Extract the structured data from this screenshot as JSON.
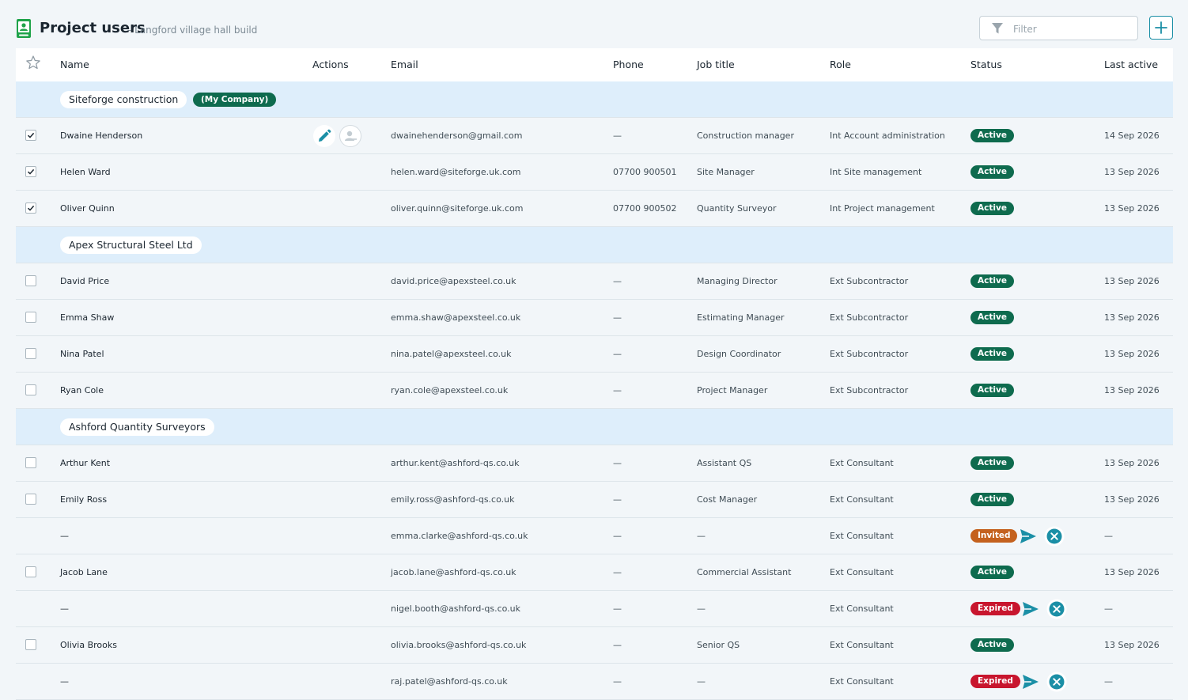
{
  "header": {
    "title": "Project users",
    "subtitle": "- Langford village hall build",
    "filter_placeholder": "Filter"
  },
  "columns": {
    "name": "Name",
    "actions": "Actions",
    "email": "Email",
    "phone": "Phone",
    "job_title": "Job title",
    "role": "Role",
    "status": "Status",
    "last_active": "Last active"
  },
  "colors": {
    "accent": "#1b8fa6",
    "active": "#0e6b4e",
    "invited": "#c4611e",
    "expired": "#c8162e",
    "group_bg": "#deeefb"
  },
  "groups": [
    {
      "name": "Siteforge construction",
      "badge": "(My Company)",
      "users": [
        {
          "checked": true,
          "name": "Dwaine Henderson",
          "email": "dwainehenderson@gmail.com",
          "phone": "—",
          "job_title": "Construction manager",
          "role": "Int Account administration",
          "status": "Active",
          "last_active": "14 Sep 2026",
          "actions": true
        },
        {
          "checked": true,
          "name": "Helen Ward",
          "email": "helen.ward@siteforge.uk.com",
          "phone": "07700 900501",
          "job_title": "Site Manager",
          "role": "Int Site management",
          "status": "Active",
          "last_active": "13 Sep 2026"
        },
        {
          "checked": true,
          "name": "Oliver Quinn",
          "email": "oliver.quinn@siteforge.uk.com",
          "phone": "07700 900502",
          "job_title": "Quantity Surveyor",
          "role": "Int Project management",
          "status": "Active",
          "last_active": "13 Sep 2026"
        }
      ]
    },
    {
      "name": "Apex Structural Steel Ltd",
      "users": [
        {
          "checked": false,
          "name": "David Price",
          "email": "david.price@apexsteel.co.uk",
          "phone": "—",
          "job_title": "Managing Director",
          "role": "Ext Subcontractor",
          "status": "Active",
          "last_active": "13 Sep 2026"
        },
        {
          "checked": false,
          "name": "Emma Shaw",
          "email": "emma.shaw@apexsteel.co.uk",
          "phone": "—",
          "job_title": "Estimating Manager",
          "role": "Ext Subcontractor",
          "status": "Active",
          "last_active": "13 Sep 2026"
        },
        {
          "checked": false,
          "name": "Nina Patel",
          "email": "nina.patel@apexsteel.co.uk",
          "phone": "—",
          "job_title": "Design Coordinator",
          "role": "Ext Subcontractor",
          "status": "Active",
          "last_active": "13 Sep 2026"
        },
        {
          "checked": false,
          "name": "Ryan Cole",
          "email": "ryan.cole@apexsteel.co.uk",
          "phone": "—",
          "job_title": "Project Manager",
          "role": "Ext Subcontractor",
          "status": "Active",
          "last_active": "13 Sep 2026"
        }
      ]
    },
    {
      "name": "Ashford Quantity Surveyors",
      "users": [
        {
          "checked": false,
          "name": "Arthur Kent",
          "email": "arthur.kent@ashford-qs.co.uk",
          "phone": "—",
          "job_title": "Assistant QS",
          "role": "Ext Consultant",
          "status": "Active",
          "last_active": "13 Sep 2026"
        },
        {
          "checked": false,
          "name": "Emily Ross",
          "email": "emily.ross@ashford-qs.co.uk",
          "phone": "—",
          "job_title": "Cost Manager",
          "role": "Ext Consultant",
          "status": "Active",
          "last_active": "13 Sep 2026"
        },
        {
          "checked": null,
          "name": "—",
          "email": "emma.clarke@ashford-qs.co.uk",
          "phone": "—",
          "job_title": "—",
          "role": "Ext Consultant",
          "status": "Invited",
          "last_active": "—",
          "invite_actions": true
        },
        {
          "checked": false,
          "name": "Jacob Lane",
          "email": "jacob.lane@ashford-qs.co.uk",
          "phone": "—",
          "job_title": "Commercial Assistant",
          "role": "Ext Consultant",
          "status": "Active",
          "last_active": "13 Sep 2026"
        },
        {
          "checked": null,
          "name": "—",
          "email": "nigel.booth@ashford-qs.co.uk",
          "phone": "—",
          "job_title": "—",
          "role": "Ext Consultant",
          "status": "Expired",
          "last_active": "—",
          "invite_actions": true
        },
        {
          "checked": false,
          "name": "Olivia Brooks",
          "email": "olivia.brooks@ashford-qs.co.uk",
          "phone": "—",
          "job_title": "Senior QS",
          "role": "Ext Consultant",
          "status": "Active",
          "last_active": "13 Sep 2026"
        },
        {
          "checked": null,
          "name": "—",
          "email": "raj.patel@ashford-qs.co.uk",
          "phone": "—",
          "job_title": "—",
          "role": "Ext Consultant",
          "status": "Expired",
          "last_active": "—",
          "invite_actions": true
        }
      ]
    }
  ]
}
